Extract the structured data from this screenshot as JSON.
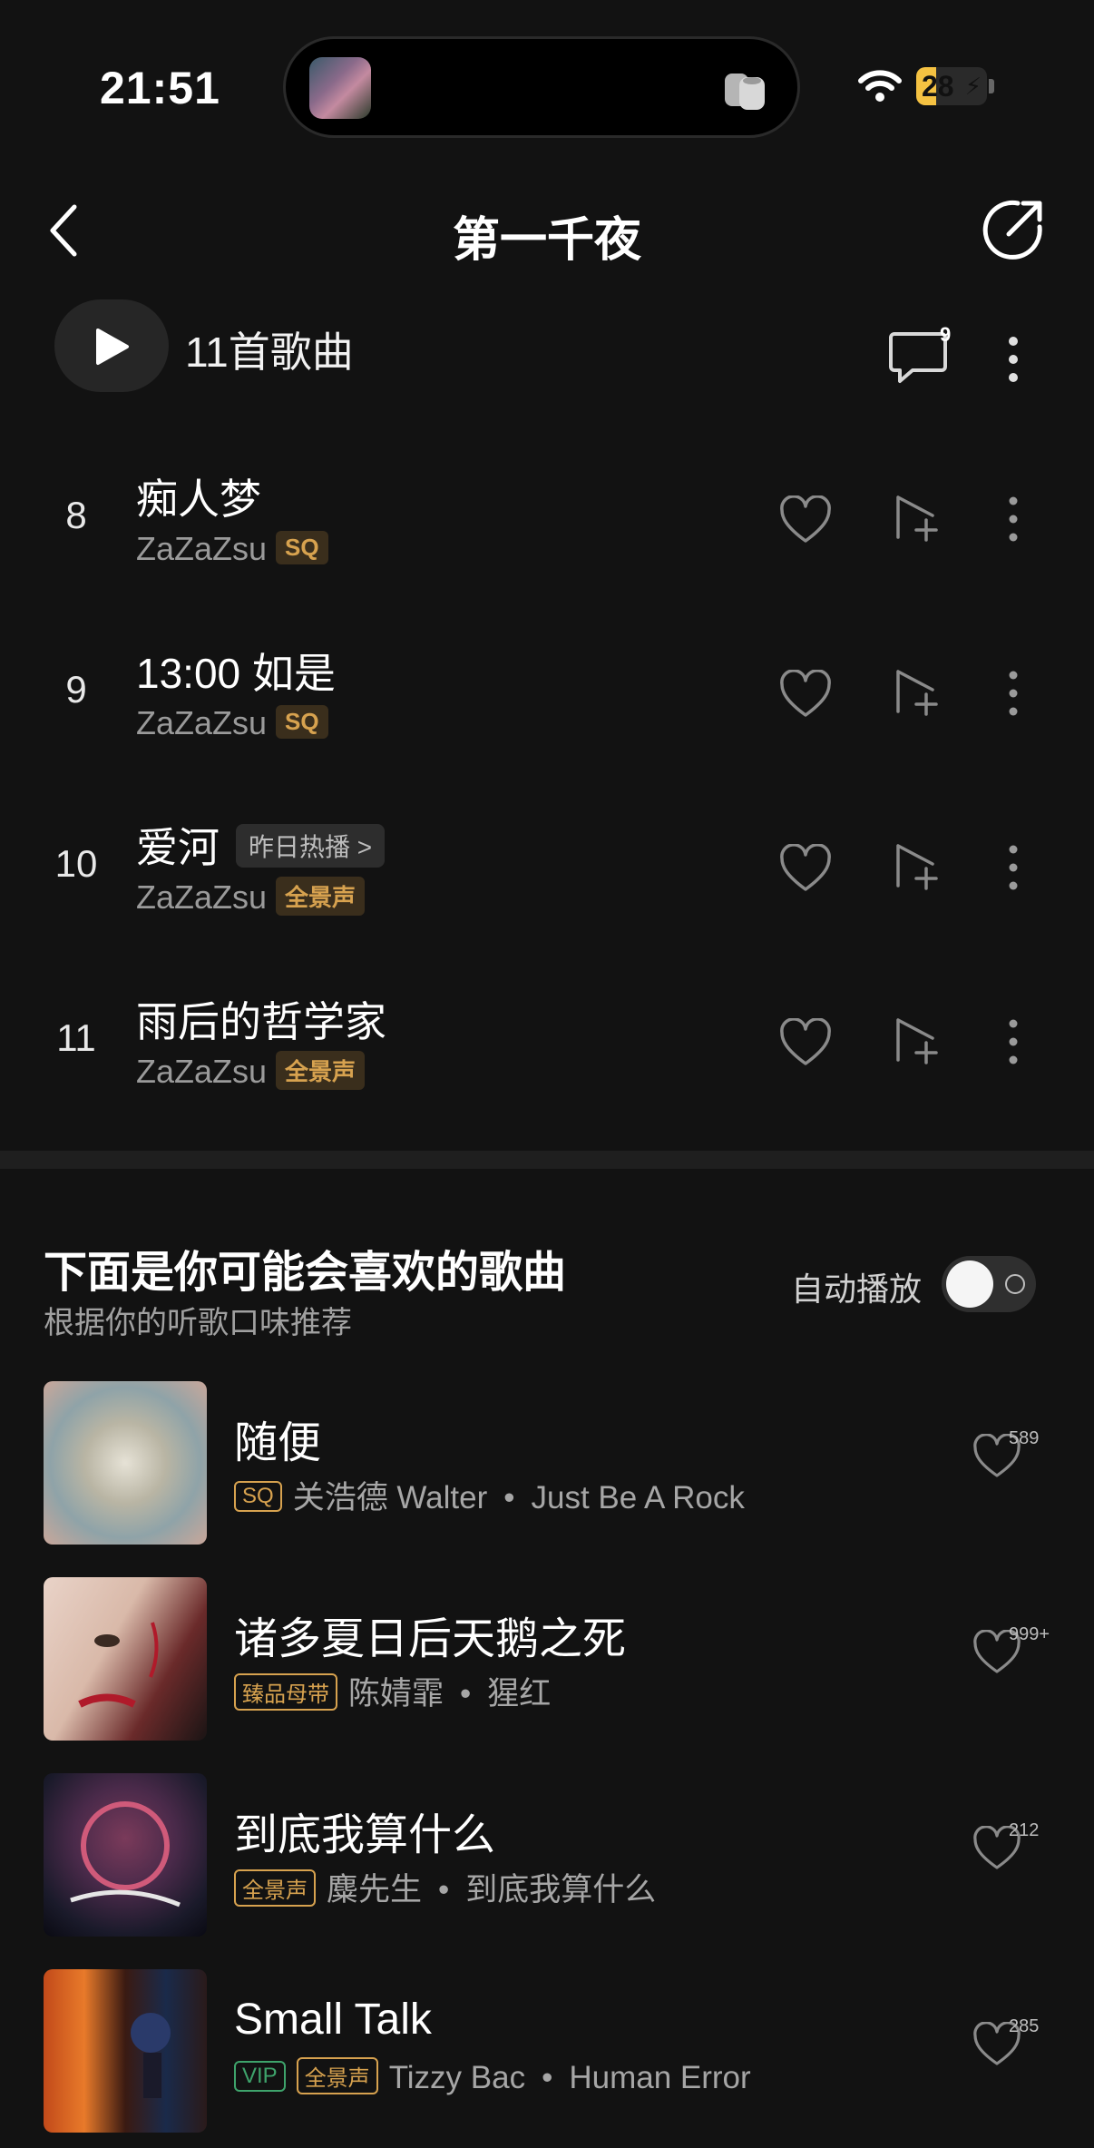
{
  "status": {
    "time": "21:51",
    "battery": "28",
    "battery_level": 0.28
  },
  "header": {
    "title": "第一千夜"
  },
  "play_row": {
    "count_label": "11首歌曲",
    "comment_count": "9"
  },
  "tracks": [
    {
      "num": "8",
      "title": "痴人梦",
      "artist": "ZaZaZsu",
      "quality": "SQ",
      "tag": ""
    },
    {
      "num": "9",
      "title": "13:00 如是",
      "artist": "ZaZaZsu",
      "quality": "SQ",
      "tag": ""
    },
    {
      "num": "10",
      "title": "爱河",
      "artist": "ZaZaZsu",
      "quality": "全景声",
      "tag": "昨日热播 >"
    },
    {
      "num": "11",
      "title": "雨后的哲学家",
      "artist": "ZaZaZsu",
      "quality": "全景声",
      "tag": ""
    }
  ],
  "recommend": {
    "title": "下面是你可能会喜欢的歌曲",
    "subtitle": "根据你的听歌口味推荐",
    "autoplay_label": "自动播放",
    "autoplay_on": false,
    "items": [
      {
        "title": "随便",
        "badges": [
          "SQ"
        ],
        "artist": "关浩德 Walter",
        "album": "Just Be A Rock",
        "likes": "589"
      },
      {
        "title": "诸多夏日后天鹅之死",
        "badges": [
          "臻品母带"
        ],
        "artist": "陈婧霏",
        "album": "猩红",
        "likes": "999+"
      },
      {
        "title": "到底我算什么",
        "badges": [
          "全景声"
        ],
        "artist": "麋先生",
        "album": "到底我算什么",
        "likes": "212"
      },
      {
        "title": "Small Talk",
        "badges": [
          "VIP",
          "全景声"
        ],
        "artist": "Tizzy Bac",
        "album": "Human Error",
        "likes": "285"
      }
    ],
    "dot": "•"
  },
  "icons": {
    "back": "chevron-left-icon",
    "share": "share-icon",
    "play": "play-icon",
    "comment": "comment-icon",
    "more": "more-vertical-icon",
    "heart": "heart-icon",
    "add_to_playlist": "add-to-playlist-icon"
  },
  "colors": {
    "background": "#121212",
    "accent_gold": "#d7a24f",
    "vip_green": "#3ea36b",
    "battery": "#f5c242"
  }
}
